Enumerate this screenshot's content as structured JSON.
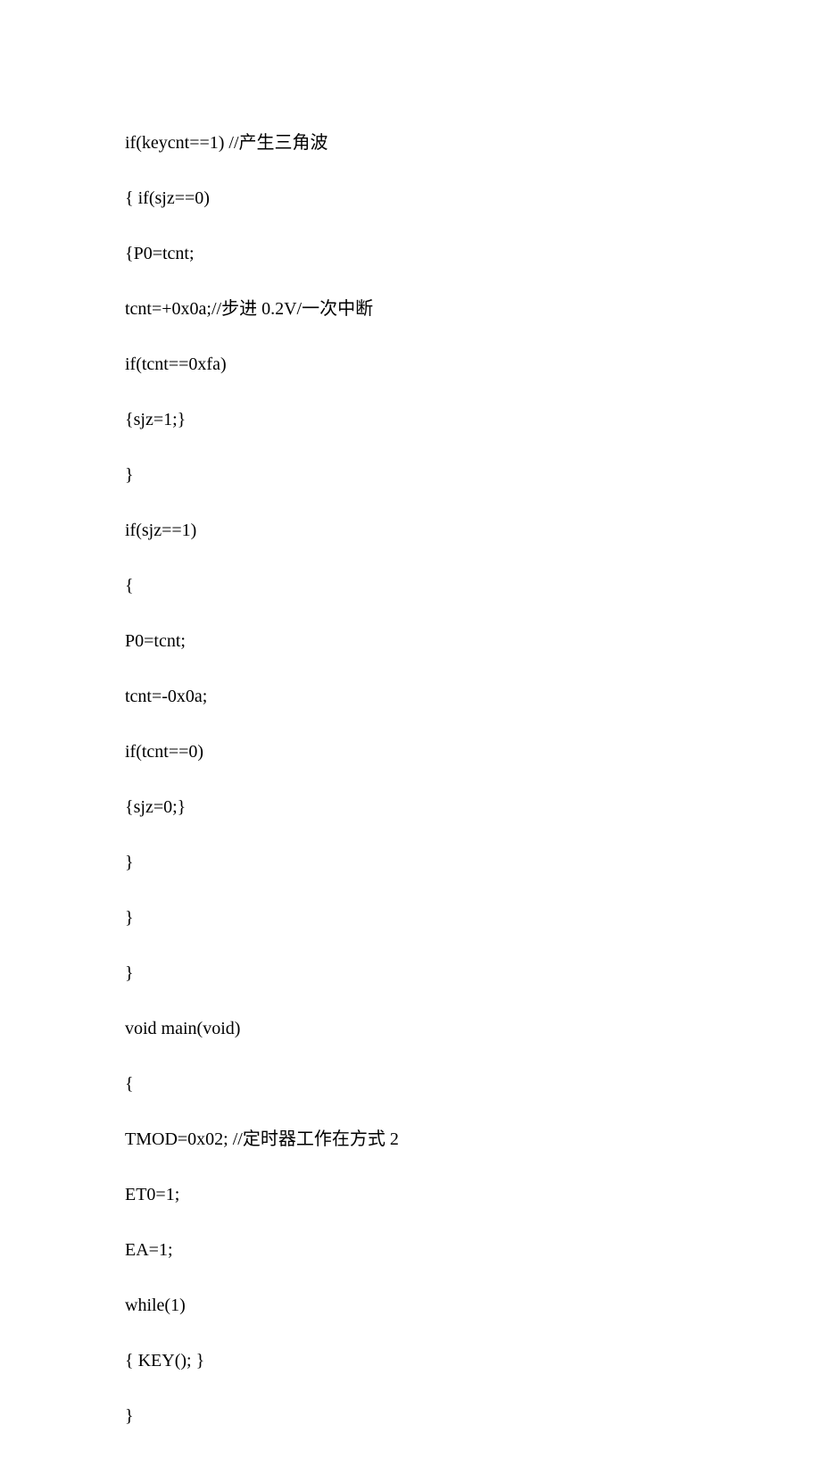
{
  "code": {
    "lines": [
      "if(keycnt==1) //产生三角波",
      "{ if(sjz==0)",
      "{P0=tcnt;",
      "tcnt=+0x0a;//步进 0.2V/一次中断",
      "if(tcnt==0xfa)",
      "{sjz=1;}",
      "}",
      "if(sjz==1)",
      "{",
      "P0=tcnt;",
      "tcnt=-0x0a;",
      "if(tcnt==0)",
      "{sjz=0;}",
      "}",
      "}",
      "}",
      "void main(void)",
      "{",
      "TMOD=0x02; //定时器工作在方式 2",
      "ET0=1;",
      "EA=1;",
      "while(1)",
      "{ KEY(); }",
      "}"
    ]
  }
}
